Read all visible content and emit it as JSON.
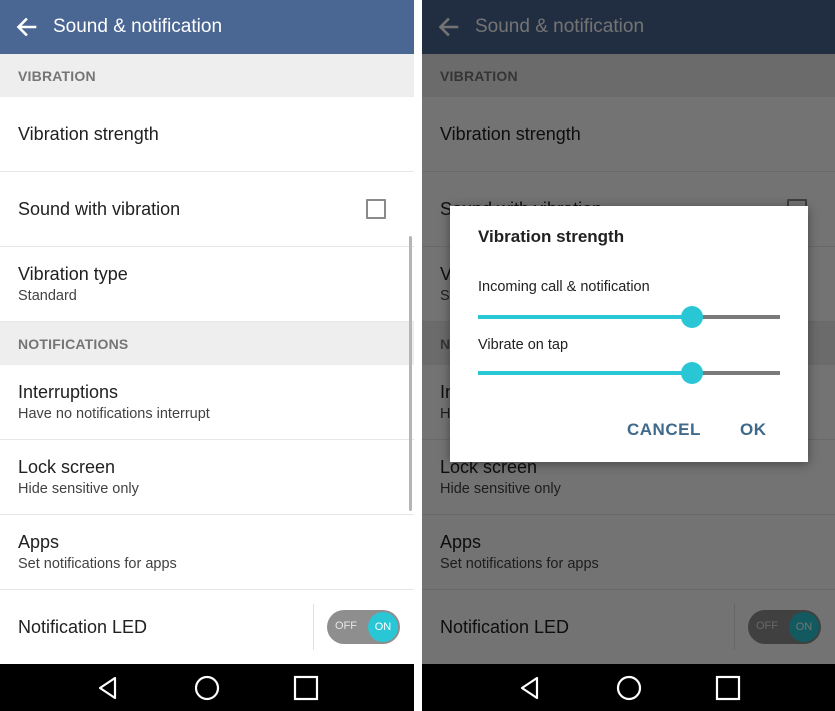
{
  "appbar": {
    "title": "Sound & notification",
    "back_icon": "arrow-left-icon"
  },
  "sections": {
    "vibration": "VIBRATION",
    "notifications": "NOTIFICATIONS"
  },
  "rows": {
    "vibration_strength": {
      "title": "Vibration strength"
    },
    "sound_with_vibration": {
      "title": "Sound with vibration",
      "checked": false
    },
    "vibration_type": {
      "title": "Vibration type",
      "sub": "Standard"
    },
    "interruptions": {
      "title": "Interruptions",
      "sub": "Have no notifications interrupt"
    },
    "lock_screen": {
      "title": "Lock screen",
      "sub": "Hide sensitive only"
    },
    "apps": {
      "title": "Apps",
      "sub": "Set notifications for apps"
    },
    "notification_led": {
      "title": "Notification LED",
      "toggle_off_label": "OFF",
      "toggle_on_label": "ON",
      "state": "on"
    }
  },
  "dialog": {
    "title": "Vibration strength",
    "sliders": [
      {
        "label": "Incoming call & notification",
        "value": 0.71
      },
      {
        "label": "Vibrate on tap",
        "value": 0.71
      }
    ],
    "cancel_label": "CANCEL",
    "ok_label": "OK"
  },
  "navbar": {
    "icons": [
      "back-triangle-icon",
      "home-circle-icon",
      "recents-square-icon"
    ]
  },
  "colors": {
    "appbar": "#4a6692",
    "accent": "#29c7d6",
    "dialog_button": "#3f6a8c",
    "section_bg": "#eeeeee"
  }
}
